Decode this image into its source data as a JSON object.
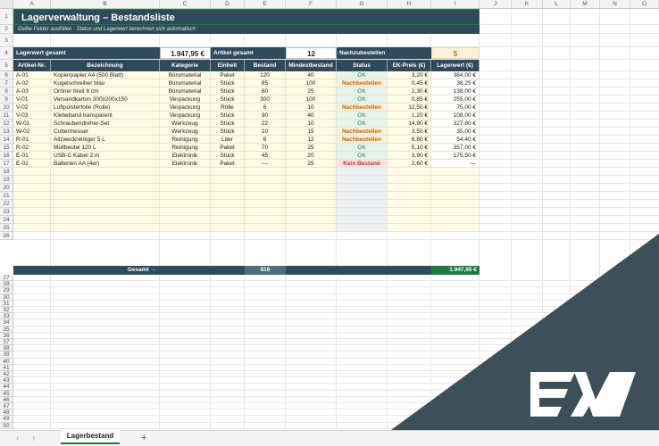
{
  "columns": [
    "A",
    "B",
    "C",
    "D",
    "E",
    "F",
    "G",
    "H",
    "I",
    "J",
    "K",
    "L",
    "M",
    "N",
    "O"
  ],
  "rows": [
    "1",
    "2",
    "3",
    "4",
    "5",
    "6",
    "7",
    "8",
    "9",
    "10",
    "11",
    "12",
    "13",
    "14",
    "15",
    "16",
    "17",
    "18",
    "19",
    "20",
    "21",
    "22",
    "23",
    "24",
    "25",
    "26",
    "27",
    "28",
    "29",
    "30",
    "31",
    "32",
    "33",
    "34",
    "35",
    "36",
    "37",
    "38",
    "39",
    "40",
    "41",
    "42",
    "43",
    "44",
    "45",
    "46",
    "47",
    "48",
    "49",
    "50",
    "51"
  ],
  "title": "Lagerverwaltung – Bestandsliste",
  "subtitle": "Gelbe Felder ausfüllen · Status und Lagerwert berechnen sich automatisch",
  "summary": {
    "lagerwert_label": "Lagerwert gesamt",
    "lagerwert_value": "1.947,95 €",
    "artikel_label": "Artikel gesamt",
    "artikel_value": "12",
    "nach_label": "Nachzubestellen",
    "nach_value": "5"
  },
  "headers": [
    "Artikel-Nr.",
    "Bezeichnung",
    "Kategorie",
    "Einheit",
    "Bestand",
    "Mindestbestand",
    "Status",
    "EK-Preis (€)",
    "Lagerwert (€)"
  ],
  "items": [
    {
      "nr": "A-01",
      "name": "Kopierpapier A4 (500 Blatt)",
      "cat": "Büromaterial",
      "unit": "Paket",
      "stock": "120",
      "min": "40",
      "status": "OK",
      "price": "3,20 €",
      "value": "384,00 €",
      "st": "ok"
    },
    {
      "nr": "A-02",
      "name": "Kugelschreiber blau",
      "cat": "Büromaterial",
      "unit": "Stück",
      "stock": "85",
      "min": "100",
      "status": "Nachbestellen",
      "price": "0,45 €",
      "value": "38,25 €",
      "st": "nach"
    },
    {
      "nr": "A-03",
      "name": "Ordner breit 8 cm",
      "cat": "Büromaterial",
      "unit": "Stück",
      "stock": "60",
      "min": "25",
      "status": "OK",
      "price": "2,30 €",
      "value": "138,00 €",
      "st": "ok"
    },
    {
      "nr": "V-01",
      "name": "Versandkarton 300x200x150",
      "cat": "Verpackung",
      "unit": "Stück",
      "stock": "300",
      "min": "100",
      "status": "OK",
      "price": "0,85 €",
      "value": "255,00 €",
      "st": "ok"
    },
    {
      "nr": "V-02",
      "name": "Luftpolsterfolie (Rolle)",
      "cat": "Verpackung",
      "unit": "Rolle",
      "stock": "6",
      "min": "10",
      "status": "Nachbestellen",
      "price": "12,50 €",
      "value": "75,00 €",
      "st": "nach"
    },
    {
      "nr": "V-03",
      "name": "Klebeband transparent",
      "cat": "Verpackung",
      "unit": "Stück",
      "stock": "90",
      "min": "40",
      "status": "OK",
      "price": "1,20 €",
      "value": "108,00 €",
      "st": "ok"
    },
    {
      "nr": "W-01",
      "name": "Schraubendreher-Set",
      "cat": "Werkzeug",
      "unit": "Stück",
      "stock": "22",
      "min": "10",
      "status": "OK",
      "price": "14,90 €",
      "value": "327,80 €",
      "st": "ok"
    },
    {
      "nr": "W-02",
      "name": "Cuttermesser",
      "cat": "Werkzeug",
      "unit": "Stück",
      "stock": "10",
      "min": "15",
      "status": "Nachbestellen",
      "price": "3,50 €",
      "value": "35,00 €",
      "st": "nach"
    },
    {
      "nr": "R-01",
      "name": "Allzweckreiniger 5 L",
      "cat": "Reinigung",
      "unit": "Liter",
      "stock": "8",
      "min": "12",
      "status": "Nachbestellen",
      "price": "6,80 €",
      "value": "54,40 €",
      "st": "nach"
    },
    {
      "nr": "R-02",
      "name": "Müllbeutel 120 L",
      "cat": "Reinigung",
      "unit": "Paket",
      "stock": "70",
      "min": "25",
      "status": "OK",
      "price": "5,10 €",
      "value": "357,00 €",
      "st": "ok"
    },
    {
      "nr": "E-01",
      "name": "USB-C Kabel 2 m",
      "cat": "Elektronik",
      "unit": "Stück",
      "stock": "45",
      "min": "20",
      "status": "OK",
      "price": "3,90 €",
      "value": "175,50 €",
      "st": "ok"
    },
    {
      "nr": "E-02",
      "name": "Batterien AA (4er)",
      "cat": "Elektronik",
      "unit": "Paket",
      "stock": "—",
      "min": "25",
      "status": "Kein Bestand",
      "price": "2,60 €",
      "value": "—",
      "st": "kein"
    }
  ],
  "total": {
    "label": "Gesamt →",
    "stock": "816",
    "value": "1.947,95 €"
  },
  "sheet_tab": "Lagerbestand",
  "add_sheet": "+",
  "nav_prev": "‹",
  "nav_next": "›",
  "colors": {
    "header": "#2f4a5b",
    "accent": "#1e7b3f",
    "ok": "#2e7d4f",
    "nach": "#b96a0a",
    "kein": "#c0392b"
  }
}
